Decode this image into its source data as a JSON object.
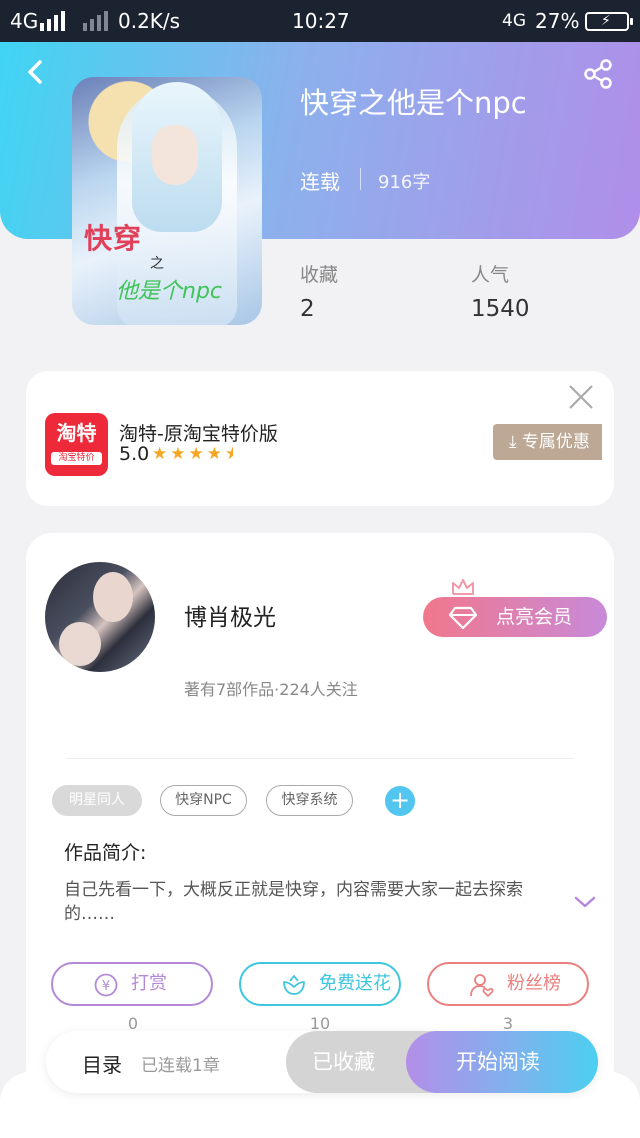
{
  "status_bar": {
    "network_left": "4G",
    "speed": "0.2K/s",
    "time": "10:27",
    "network_right": "4G",
    "battery": "27%"
  },
  "book": {
    "title": "快穿之他是个npc",
    "status": "连载",
    "words": "916字",
    "cover_text": {
      "line1": "快穿",
      "line2": "之",
      "line3": "他是个npc"
    },
    "stats": [
      {
        "label": "收藏",
        "value": "2"
      },
      {
        "label": "人气",
        "value": "1540"
      }
    ]
  },
  "ad": {
    "icon_text": "淘特",
    "icon_sub": "淘宝特价",
    "title": "淘特-原淘宝特价版",
    "rating": "5.0",
    "stars": 4.5,
    "button": "专属优惠"
  },
  "author": {
    "name": "博肖极光",
    "meta": "著有7部作品·224人关注",
    "vip_button": "点亮会员"
  },
  "tags": [
    "明星同人",
    "快穿NPC",
    "快穿系统"
  ],
  "intro": {
    "label": "作品简介:",
    "text": "自己先看一下，大概反正就是快穿，内容需要大家一起去探索的……"
  },
  "actions": [
    {
      "label": "打赏",
      "count": "0",
      "color": "#b48ad8"
    },
    {
      "label": "免费送花",
      "count": "10",
      "color": "#3dc6de"
    },
    {
      "label": "粉丝榜",
      "count": "3",
      "color": "#ea7f7f"
    }
  ],
  "bottom": {
    "toc_label": "目录",
    "toc_sub": "已连载1章",
    "favorite": "已收藏",
    "read": "开始阅读"
  },
  "colors": {
    "header_start": "#3fd5f2",
    "header_end": "#b08ee9",
    "accent_blue": "#52c6ef"
  }
}
